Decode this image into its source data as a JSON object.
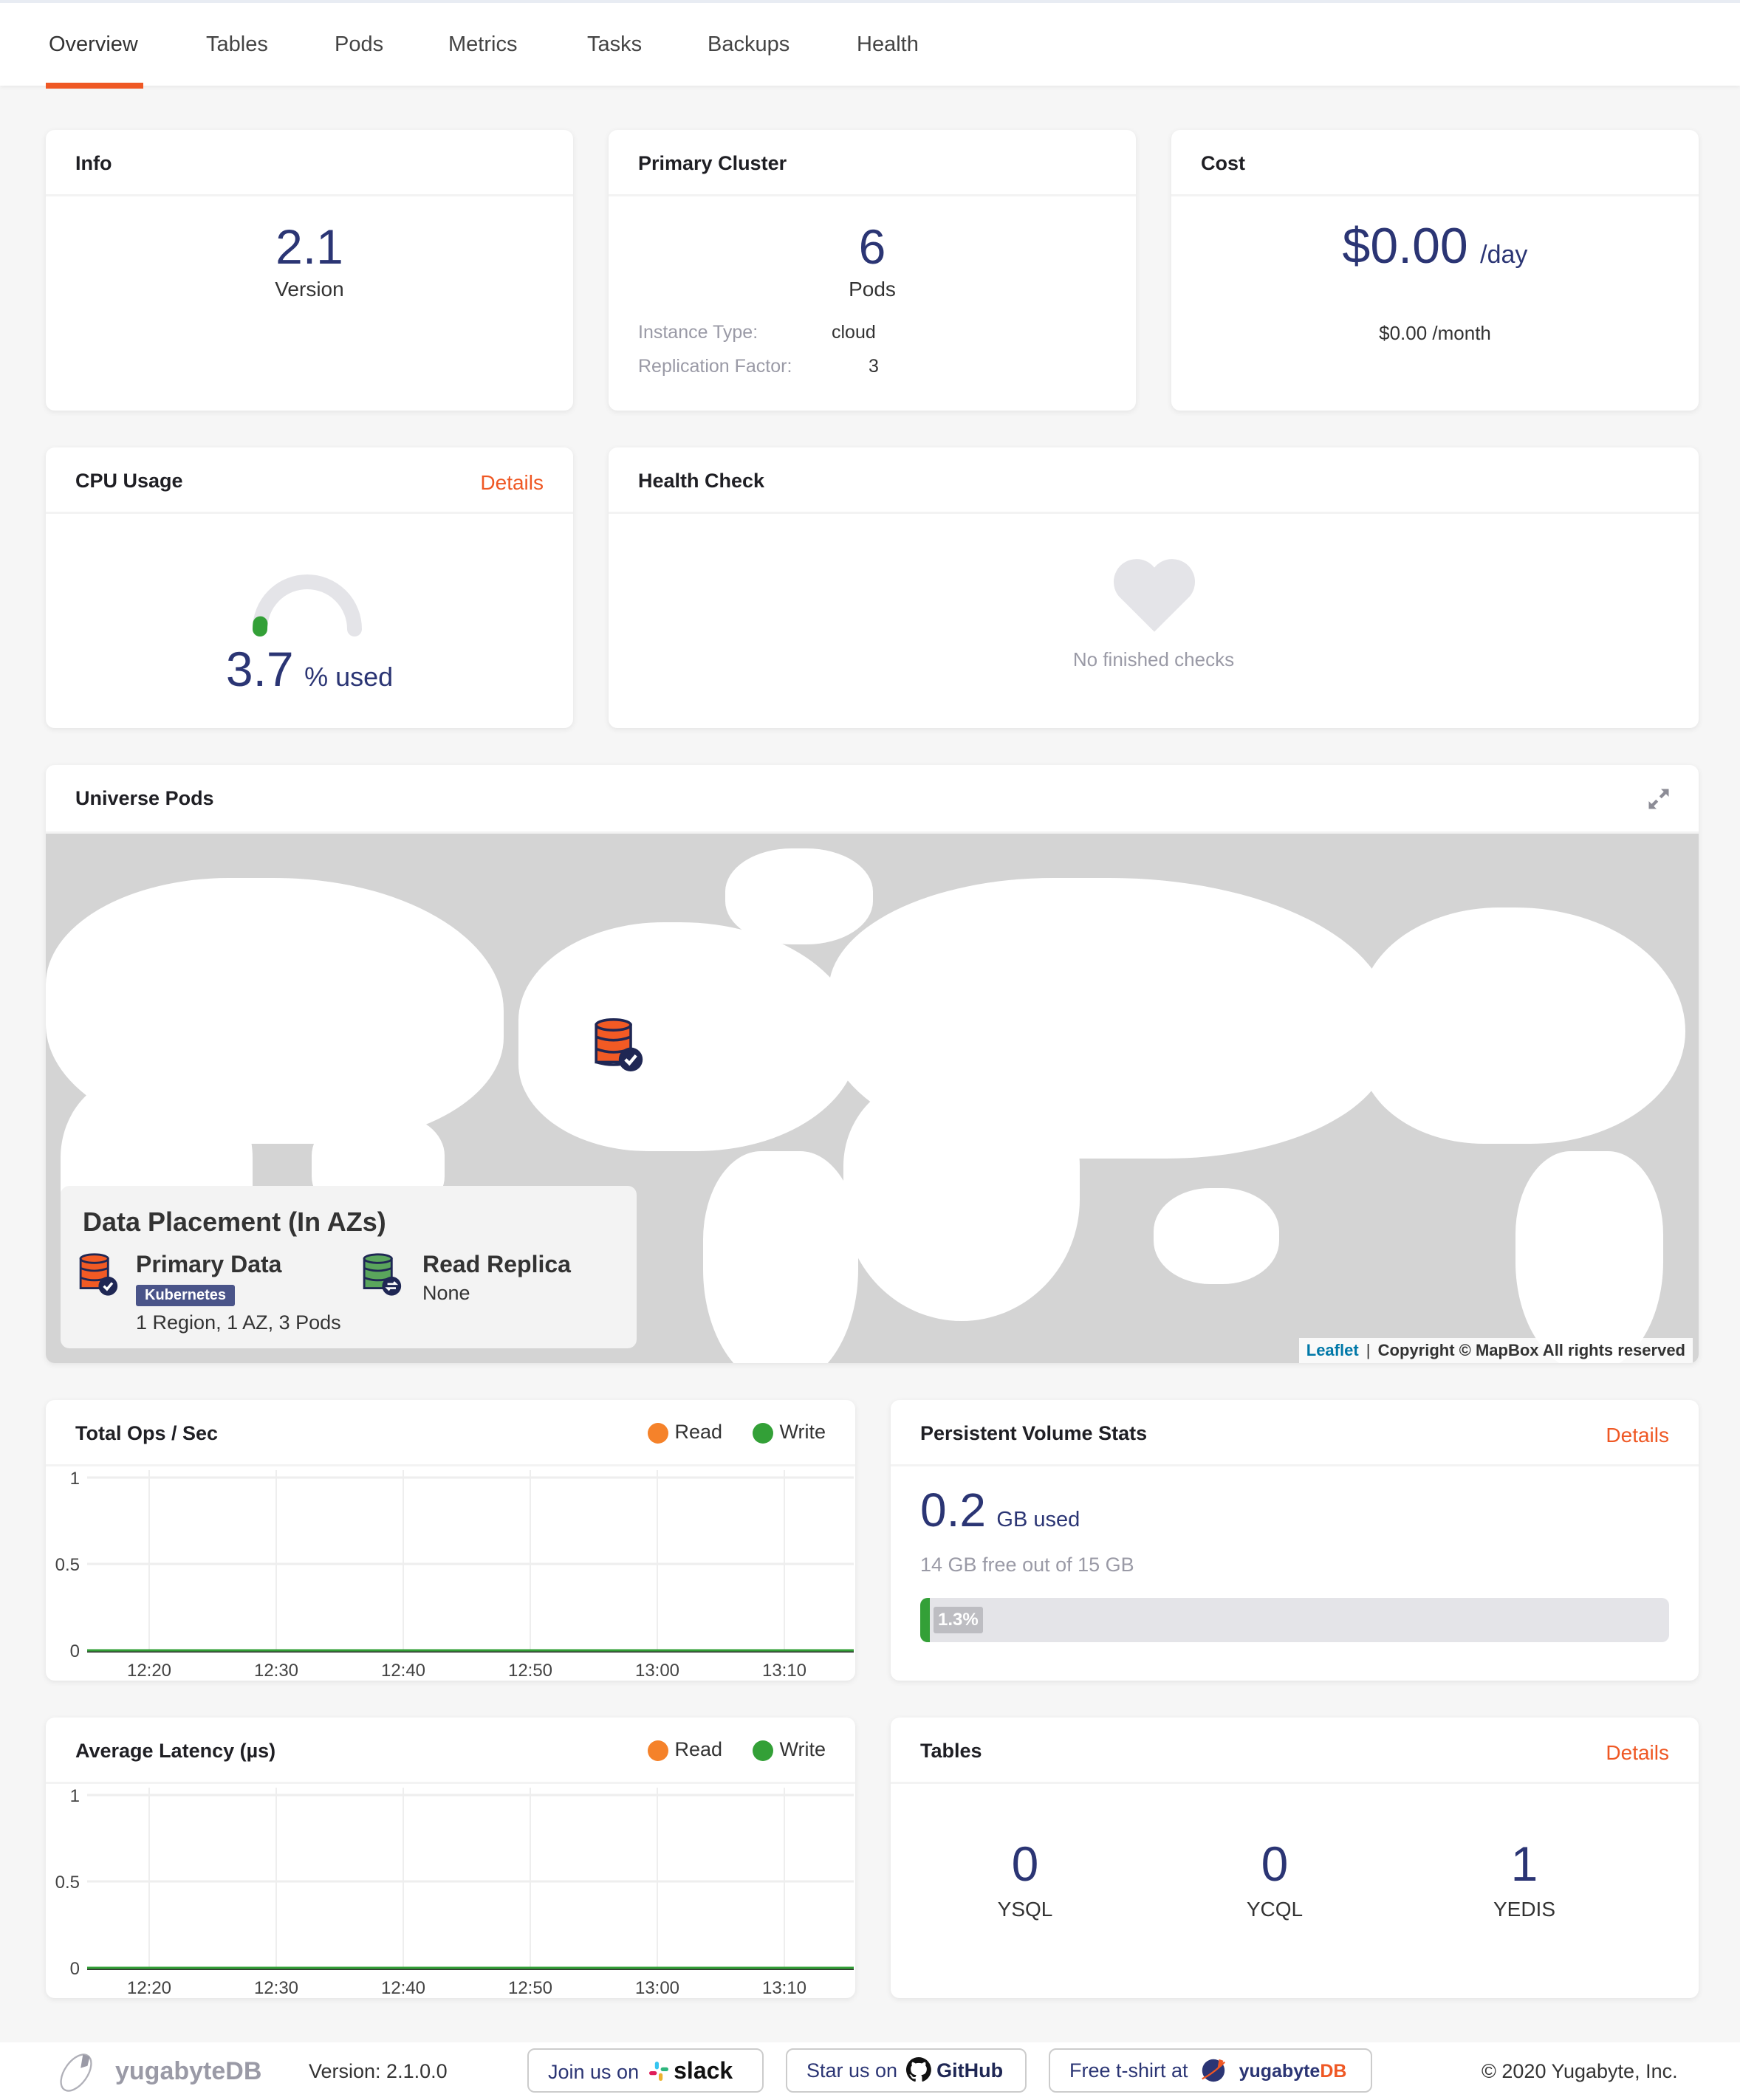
{
  "nav": {
    "tabs": [
      {
        "label": "Overview",
        "active": true
      },
      {
        "label": "Tables"
      },
      {
        "label": "Pods"
      },
      {
        "label": "Metrics"
      },
      {
        "label": "Tasks"
      },
      {
        "label": "Backups"
      },
      {
        "label": "Health"
      }
    ]
  },
  "colors": {
    "accent": "#ef5824",
    "primary_text": "#2b3574",
    "read": "#f5822a",
    "write": "#33a037"
  },
  "info": {
    "title": "Info",
    "version_value": "2.1",
    "version_label": "Version"
  },
  "primary_cluster": {
    "title": "Primary Cluster",
    "pods_value": "6",
    "pods_label": "Pods",
    "instance_type_label": "Instance Type:",
    "instance_type_value": "cloud",
    "replication_factor_label": "Replication Factor:",
    "replication_factor_value": "3"
  },
  "cost": {
    "title": "Cost",
    "daily_value": "$0.00",
    "daily_unit": "/day",
    "monthly": "$0.00 /month"
  },
  "cpu": {
    "title": "CPU Usage",
    "details_label": "Details",
    "value": "3.7",
    "unit": "% used",
    "percent": 3.7
  },
  "health_check": {
    "title": "Health Check",
    "empty_message": "No finished checks"
  },
  "universe_pods": {
    "title": "Universe Pods",
    "legend": {
      "title": "Data Placement (In AZs)",
      "primary_label": "Primary Data",
      "primary_badge": "Kubernetes",
      "primary_summary": "1 Region, 1 AZ, 3 Pods",
      "replica_label": "Read Replica",
      "replica_summary": "None"
    },
    "attribution_link": "Leaflet",
    "attribution_text": "Copyright © MapBox All rights reserved"
  },
  "ops_chart": {
    "title": "Total Ops / Sec",
    "legend": [
      "Read",
      "Write"
    ]
  },
  "latency_chart": {
    "title": "Average Latency (µs)",
    "legend": [
      "Read",
      "Write"
    ]
  },
  "persistent_volume": {
    "title": "Persistent Volume Stats",
    "details_label": "Details",
    "used_value": "0.2",
    "used_unit": "GB used",
    "free_text": "14 GB free out of 15 GB",
    "percent_label": "1.3%",
    "percent": 1.3
  },
  "tables": {
    "title": "Tables",
    "details_label": "Details",
    "counts": [
      {
        "value": "0",
        "label": "YSQL"
      },
      {
        "value": "0",
        "label": "YCQL"
      },
      {
        "value": "1",
        "label": "YEDIS"
      }
    ]
  },
  "footer": {
    "brand": "yugabyteDB",
    "version": "Version: 2.1.0.0",
    "slack_prefix": "Join us on",
    "slack_label": "slack",
    "github_prefix": "Star us on",
    "github_label": "GitHub",
    "tshirt_prefix": "Free t-shirt at",
    "tshirt_brand_a": "yugabyte",
    "tshirt_brand_b": "DB",
    "copyright": "© 2020 Yugabyte, Inc."
  },
  "chart_data": [
    {
      "type": "line",
      "title": "Total Ops / Sec",
      "x": [
        "12:20",
        "12:30",
        "12:40",
        "12:50",
        "13:00",
        "13:10"
      ],
      "series": [
        {
          "name": "Read",
          "values": [
            0,
            0,
            0,
            0,
            0,
            0
          ]
        },
        {
          "name": "Write",
          "values": [
            0,
            0,
            0,
            0,
            0,
            0
          ]
        }
      ],
      "yticks": [
        "0",
        "0.5",
        "1"
      ],
      "ylim": [
        0,
        1
      ],
      "grid": true,
      "legend": "top-right"
    },
    {
      "type": "line",
      "title": "Average Latency (µs)",
      "x": [
        "12:20",
        "12:30",
        "12:40",
        "12:50",
        "13:00",
        "13:10"
      ],
      "series": [
        {
          "name": "Read",
          "values": [
            0,
            0,
            0,
            0,
            0,
            0
          ]
        },
        {
          "name": "Write",
          "values": [
            0,
            0,
            0,
            0,
            0,
            0
          ]
        }
      ],
      "yticks": [
        "0",
        "0.5",
        "1"
      ],
      "ylim": [
        0,
        1
      ],
      "grid": true,
      "legend": "top-right"
    }
  ]
}
